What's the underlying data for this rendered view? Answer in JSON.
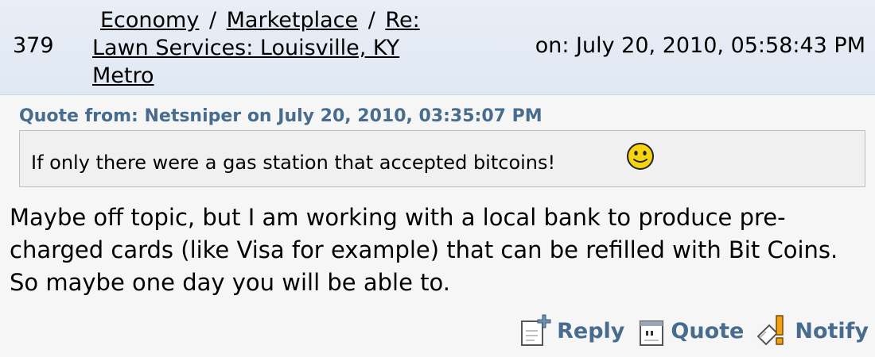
{
  "header": {
    "post_number": "379",
    "breadcrumb": [
      {
        "label": "Economy"
      },
      {
        "label": "Marketplace"
      },
      {
        "label": "Re: Lawn Services: Louisville, KY Metro"
      }
    ],
    "separator": "/",
    "posted_on": "on: July 20, 2010, 05:58:43 PM"
  },
  "quote": {
    "header": "Quote from: Netsniper on July 20, 2010, 03:35:07 PM",
    "text": "If only there were a gas station that accepted bitcoins!",
    "emoticon": "smiley-icon"
  },
  "post": {
    "body": "Maybe off topic, but I am working with a local bank to produce pre-charged cards (like Visa for example) that can be refilled with Bit Coins. So maybe one day you will be able to."
  },
  "actions": [
    {
      "label": "Reply",
      "icon": "reply-icon"
    },
    {
      "label": "Quote",
      "icon": "quote-icon"
    },
    {
      "label": "Notify",
      "icon": "notify-icon"
    }
  ],
  "colors": {
    "header_bg": "#e3eaf3",
    "link_blue": "#476c8e",
    "page_bg": "#f6f6f6",
    "quote_bg": "#f0f0f0"
  }
}
